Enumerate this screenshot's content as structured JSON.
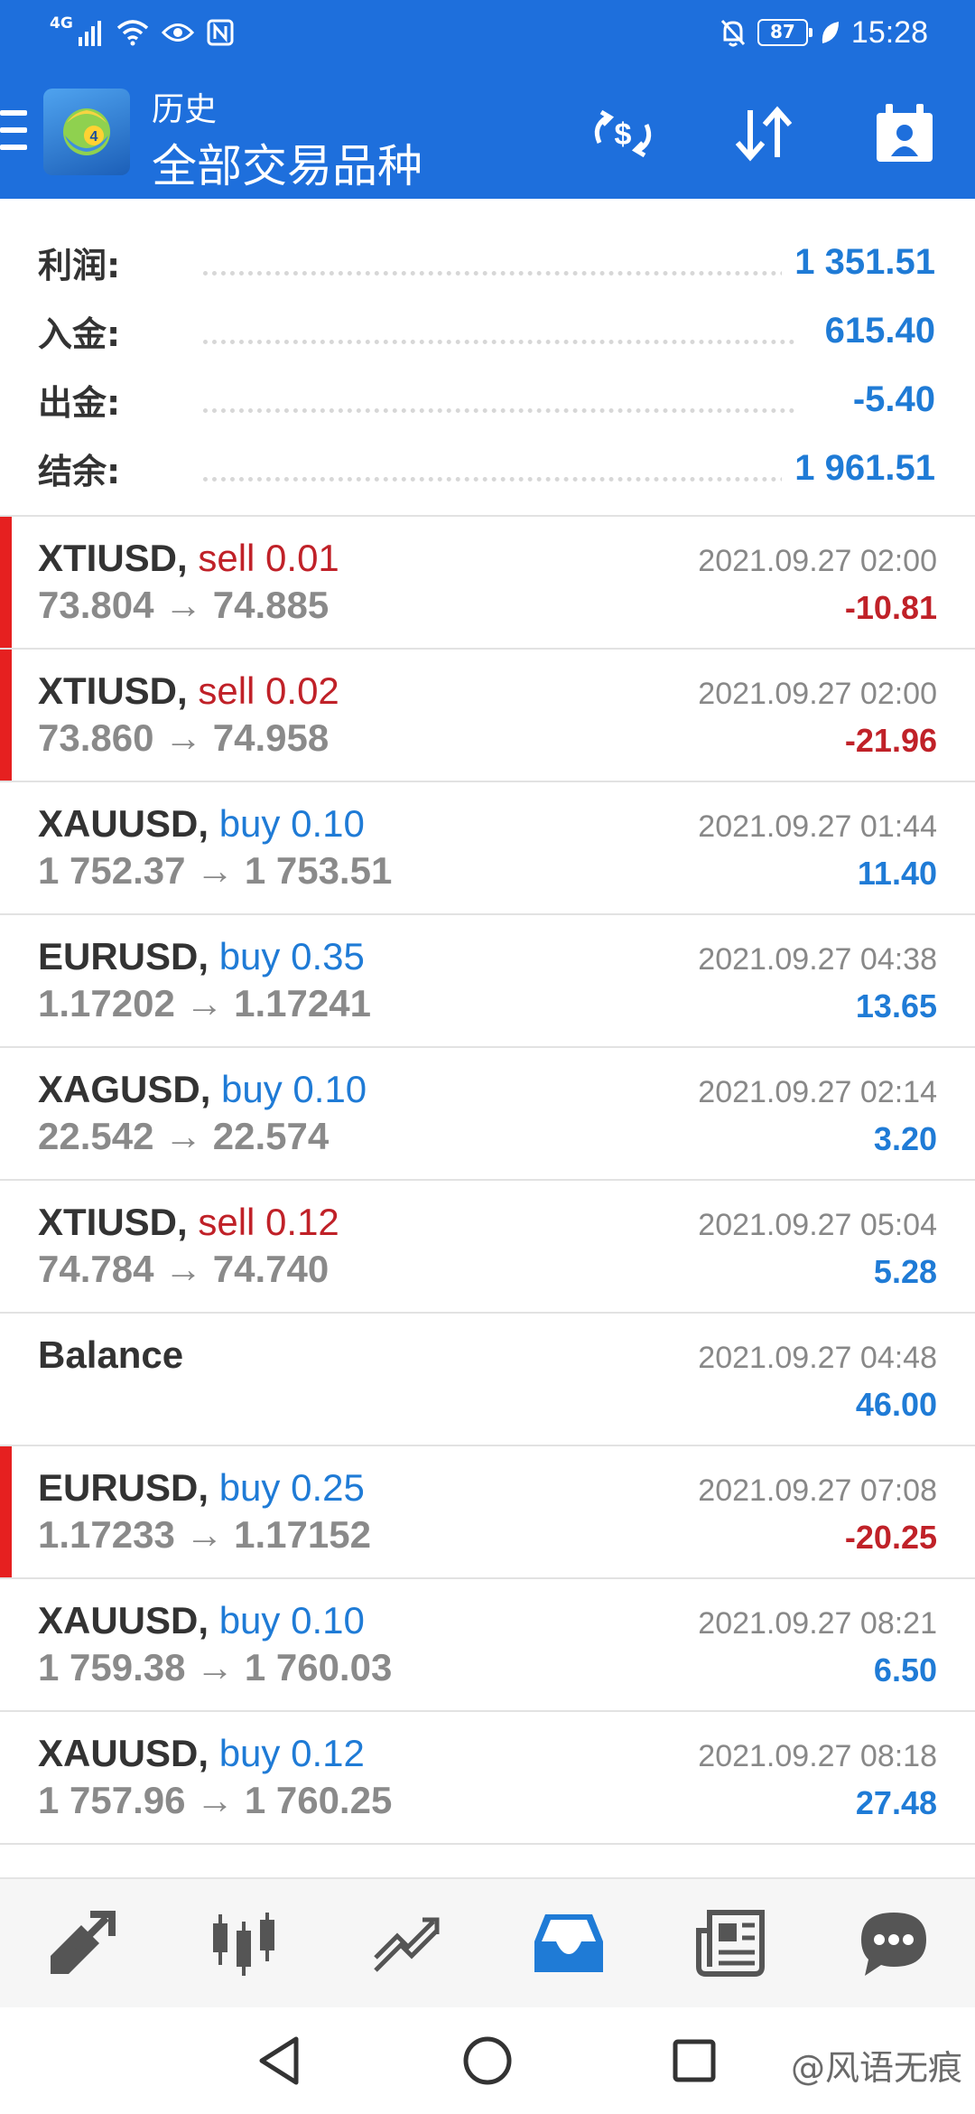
{
  "status_bar": {
    "network": "4G",
    "battery": "87",
    "time": "15:28"
  },
  "app_bar": {
    "title_small": "历史",
    "title_large": "全部交易品种",
    "colors": {
      "background": "#1e6fdc"
    }
  },
  "summary": {
    "rows": [
      {
        "label": "利润:",
        "value": "1 351.51"
      },
      {
        "label": "入金:",
        "value": "615.40"
      },
      {
        "label": "出金:",
        "value": "-5.40"
      },
      {
        "label": "结余:",
        "value": "1 961.51"
      }
    ]
  },
  "trades": [
    {
      "symbol": "XTIUSD,",
      "side": "sell 0.01",
      "prices": "73.804 → 74.885",
      "time": "2021.09.27 02:00",
      "profit": "-10.81"
    },
    {
      "symbol": "XTIUSD,",
      "side": "sell 0.02",
      "prices": "73.860 → 74.958",
      "time": "2021.09.27 02:00",
      "profit": "-21.96"
    },
    {
      "symbol": "XAUUSD,",
      "side": "buy 0.10",
      "prices": "1 752.37 → 1 753.51",
      "time": "2021.09.27 01:44",
      "profit": "11.40"
    },
    {
      "symbol": "EURUSD,",
      "side": "buy 0.35",
      "prices": "1.17202 → 1.17241",
      "time": "2021.09.27 04:38",
      "profit": "13.65"
    },
    {
      "symbol": "XAGUSD,",
      "side": "buy 0.10",
      "prices": "22.542 → 22.574",
      "time": "2021.09.27 02:14",
      "profit": "3.20"
    },
    {
      "symbol": "XTIUSD,",
      "side": "sell 0.12",
      "prices": "74.784 → 74.740",
      "time": "2021.09.27 05:04",
      "profit": "5.28"
    },
    {
      "symbol": "Balance",
      "side": "",
      "prices": "",
      "time": "2021.09.27 04:48",
      "profit": "46.00"
    },
    {
      "symbol": "EURUSD,",
      "side": "buy 0.25",
      "prices": "1.17233 → 1.17152",
      "time": "2021.09.27 07:08",
      "profit": "-20.25"
    },
    {
      "symbol": "XAUUSD,",
      "side": "buy 0.10",
      "prices": "1 759.38 → 1 760.03",
      "time": "2021.09.27 08:21",
      "profit": "6.50"
    },
    {
      "symbol": "XAUUSD,",
      "side": "buy 0.12",
      "prices": "1 757.96 → 1 760.25",
      "time": "2021.09.27 08:18",
      "profit": "27.48"
    }
  ],
  "bottom_nav": {
    "items": [
      {
        "icon": "quotes-arrows-icon"
      },
      {
        "icon": "candlestick-chart-icon"
      },
      {
        "icon": "trend-chart-icon"
      },
      {
        "icon": "history-inbox-icon",
        "active": true
      },
      {
        "icon": "news-icon"
      },
      {
        "icon": "chat-icon"
      }
    ],
    "colors": {
      "active": "#1f7bd6",
      "inactive": "#555555"
    }
  },
  "watermark": "@风语无痕",
  "colors": {
    "sell": "#c02128",
    "buy": "#1f7bd6",
    "loss_marker": "#e62020"
  }
}
